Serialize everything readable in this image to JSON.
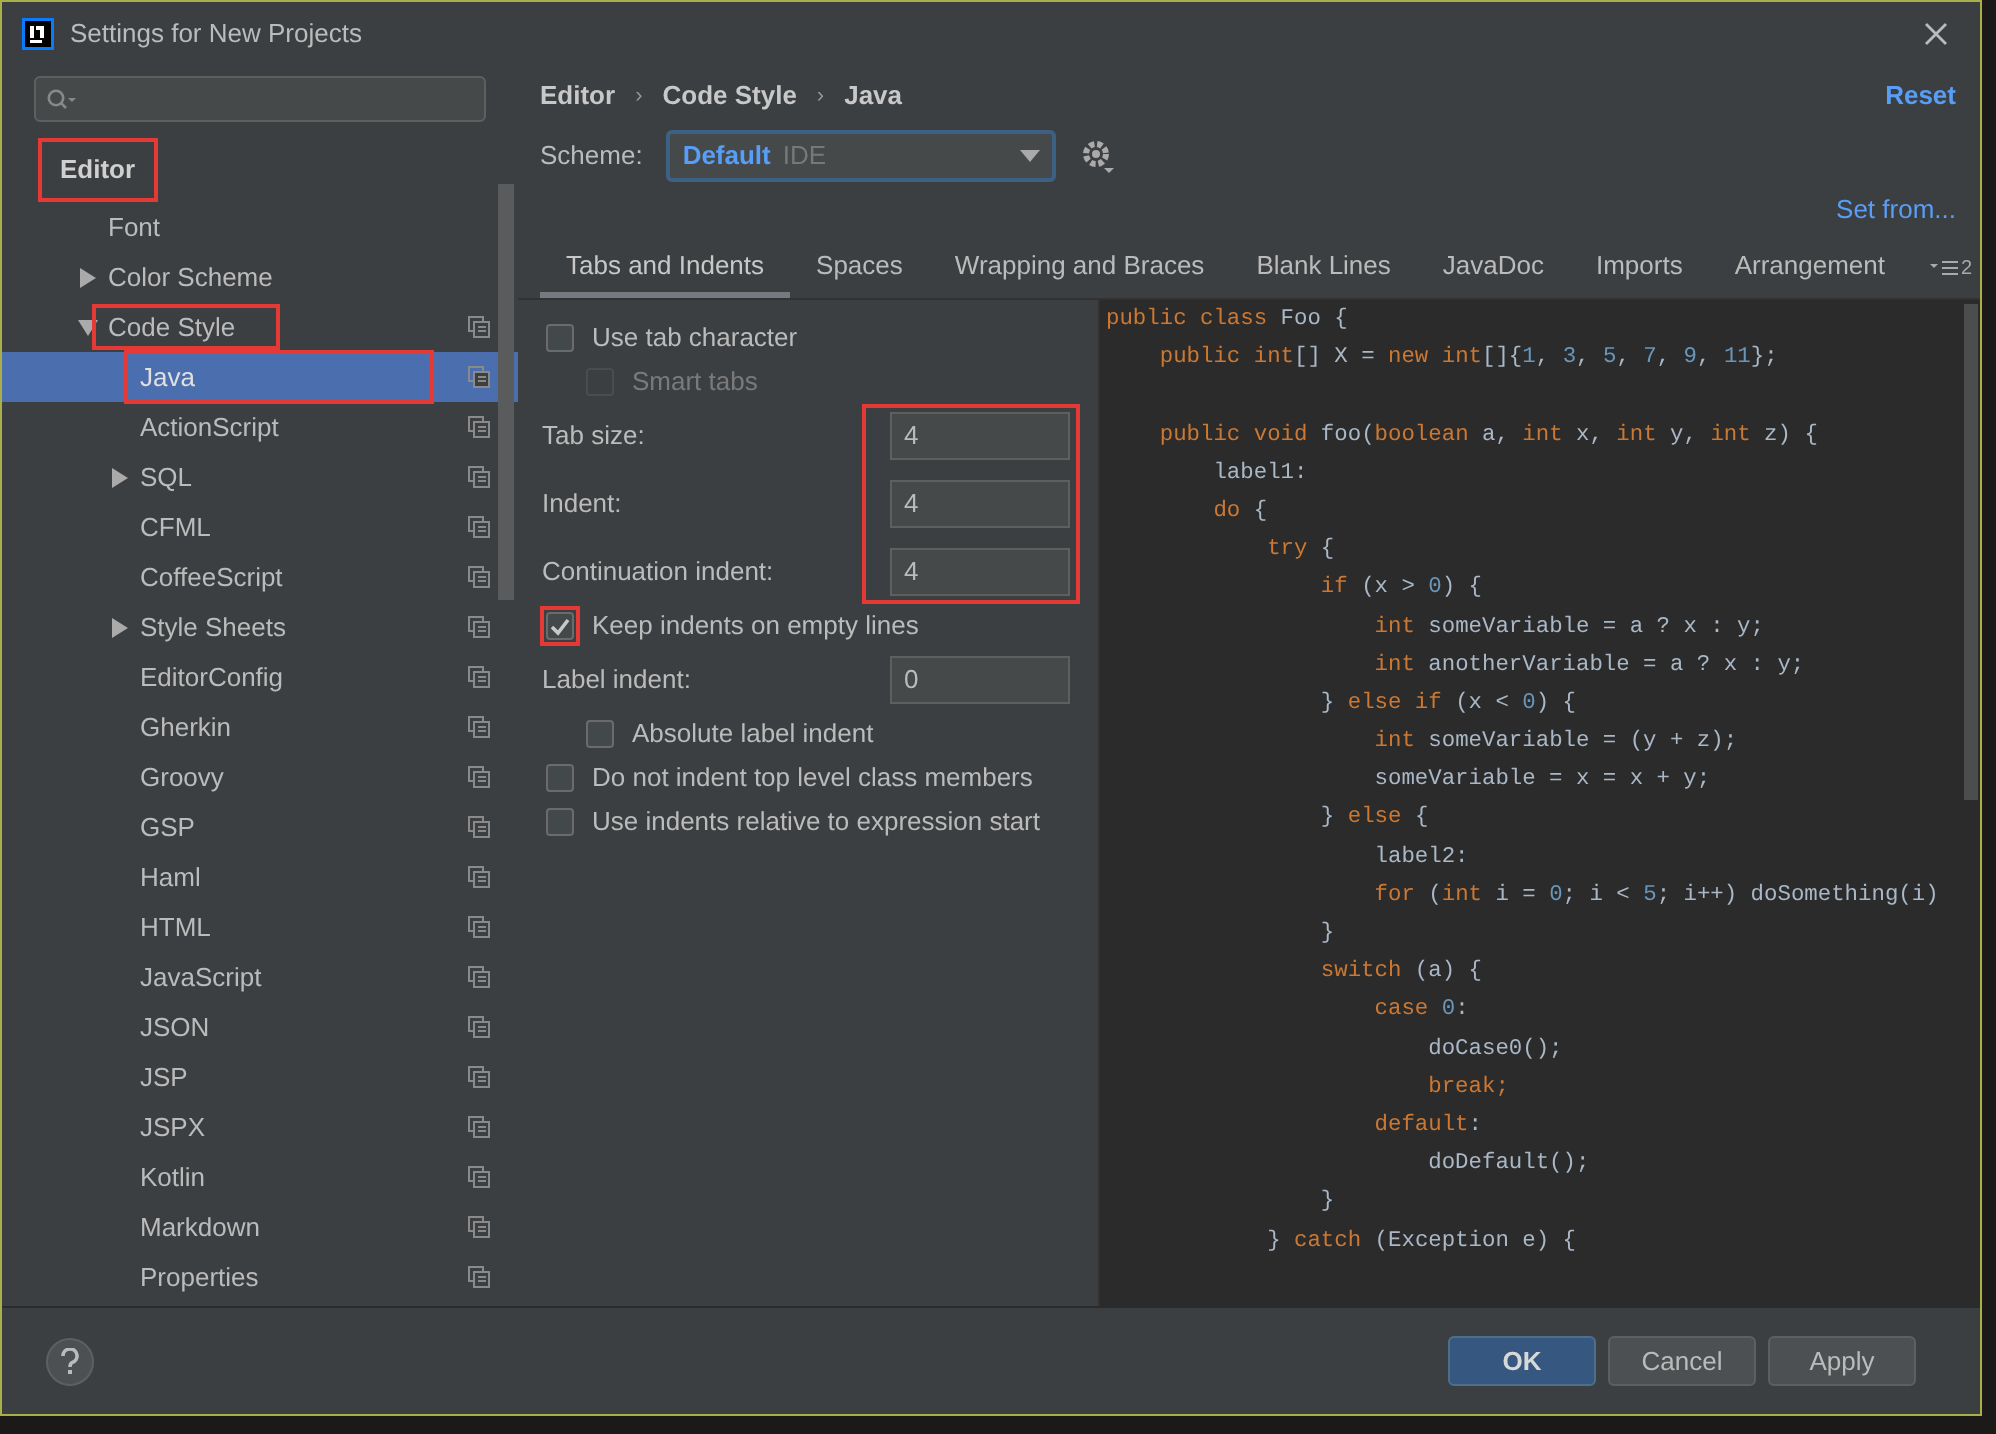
{
  "window": {
    "title": "Settings for New Projects"
  },
  "sidebar": {
    "header": {
      "label": "Editor",
      "highlighted": true
    },
    "items": [
      {
        "label": "Font",
        "selected": false,
        "highlighted": false
      },
      {
        "label": "Color Scheme",
        "expanded": false,
        "selected": false,
        "highlighted": false
      },
      {
        "label": "Code Style",
        "expanded": true,
        "selected": false,
        "highlighted": true,
        "scheme_icon": true,
        "children": [
          {
            "label": "Java",
            "selected": true,
            "highlighted": true,
            "scheme_icon": true
          },
          {
            "label": "ActionScript",
            "selected": false,
            "highlighted": false,
            "scheme_icon": true
          },
          {
            "label": "SQL",
            "expanded": false,
            "selected": false,
            "highlighted": false,
            "scheme_icon": true
          },
          {
            "label": "CFML",
            "selected": false,
            "highlighted": false,
            "scheme_icon": true
          },
          {
            "label": "CoffeeScript",
            "selected": false,
            "highlighted": false,
            "scheme_icon": true
          },
          {
            "label": "Style Sheets",
            "expanded": false,
            "selected": false,
            "highlighted": false,
            "scheme_icon": true
          },
          {
            "label": "EditorConfig",
            "selected": false,
            "highlighted": false,
            "scheme_icon": true
          },
          {
            "label": "Gherkin",
            "selected": false,
            "highlighted": false,
            "scheme_icon": true
          },
          {
            "label": "Groovy",
            "selected": false,
            "highlighted": false,
            "scheme_icon": true
          },
          {
            "label": "GSP",
            "selected": false,
            "highlighted": false,
            "scheme_icon": true
          },
          {
            "label": "Haml",
            "selected": false,
            "highlighted": false,
            "scheme_icon": true
          },
          {
            "label": "HTML",
            "selected": false,
            "highlighted": false,
            "scheme_icon": true
          },
          {
            "label": "JavaScript",
            "selected": false,
            "highlighted": false,
            "scheme_icon": true
          },
          {
            "label": "JSON",
            "selected": false,
            "highlighted": false,
            "scheme_icon": true
          },
          {
            "label": "JSP",
            "selected": false,
            "highlighted": false,
            "scheme_icon": true
          },
          {
            "label": "JSPX",
            "selected": false,
            "highlighted": false,
            "scheme_icon": true
          },
          {
            "label": "Kotlin",
            "selected": false,
            "highlighted": false,
            "scheme_icon": true
          },
          {
            "label": "Markdown",
            "selected": false,
            "highlighted": false,
            "scheme_icon": true
          },
          {
            "label": "Properties",
            "selected": false,
            "highlighted": false,
            "scheme_icon": true
          }
        ]
      }
    ]
  },
  "breadcrumb": [
    {
      "kind": "crumb",
      "text": "Editor"
    },
    {
      "kind": "separator",
      "text": "›"
    },
    {
      "kind": "crumb",
      "text": "Code Style"
    },
    {
      "kind": "separator",
      "text": "›"
    },
    {
      "kind": "crumb",
      "text": "Java"
    }
  ],
  "reset": "Reset",
  "scheme": {
    "label": "Scheme:",
    "value": "Default",
    "qualifier": "IDE"
  },
  "set_from": "Set from...",
  "tabs": [
    {
      "label": "Tabs and Indents",
      "selected": true
    },
    {
      "label": "Spaces",
      "selected": false
    },
    {
      "label": "Wrapping and Braces",
      "selected": false
    },
    {
      "label": "Blank Lines",
      "selected": false
    },
    {
      "label": "JavaDoc",
      "selected": false
    },
    {
      "label": "Imports",
      "selected": false
    },
    {
      "label": "Arrangement",
      "selected": false
    }
  ],
  "tabs_overflow": "2",
  "options": [
    {
      "kind": "checkbox",
      "label": "Use tab character",
      "checked": false,
      "disabled": false,
      "highlighted": false,
      "children": [
        {
          "kind": "checkbox",
          "label": "Smart tabs",
          "checked": false,
          "disabled": true,
          "highlighted": false
        }
      ]
    },
    {
      "kind": "field_group",
      "highlighted": true,
      "fields": [
        {
          "label": "Tab size:",
          "value": "4"
        },
        {
          "label": "Indent:",
          "value": "4"
        },
        {
          "label": "Continuation indent:",
          "value": "4"
        }
      ]
    },
    {
      "kind": "checkbox",
      "label": "Keep indents on empty lines",
      "checked": true,
      "disabled": false,
      "highlighted": true
    },
    {
      "kind": "field_group",
      "highlighted": false,
      "fields": [
        {
          "label": "Label indent:",
          "value": "0"
        }
      ],
      "children": [
        {
          "kind": "checkbox",
          "label": "Absolute label indent",
          "checked": false,
          "disabled": false,
          "highlighted": false
        }
      ]
    },
    {
      "kind": "checkbox",
      "label": "Do not indent top level class members",
      "checked": false,
      "disabled": false,
      "highlighted": false
    },
    {
      "kind": "checkbox",
      "label": "Use indents relative to expression start",
      "checked": false,
      "disabled": false,
      "highlighted": false
    }
  ],
  "code": [
    {
      "kind": "code",
      "tokens": [
        {
          "text": "public class ",
          "kind": "kw"
        },
        {
          "text": "Foo {",
          "kind": "plain"
        }
      ]
    },
    {
      "kind": "code",
      "tokens": [
        {
          "text": "    public int",
          "kind": "kw"
        },
        {
          "text": "[] X = ",
          "kind": "plain"
        },
        {
          "text": "new int",
          "kind": "kw"
        },
        {
          "text": "[]{",
          "kind": "plain"
        },
        {
          "text": "1",
          "kind": "num"
        },
        {
          "text": ", ",
          "kind": "plain"
        },
        {
          "text": "3",
          "kind": "num"
        },
        {
          "text": ", ",
          "kind": "plain"
        },
        {
          "text": "5",
          "kind": "num"
        },
        {
          "text": ", ",
          "kind": "plain"
        },
        {
          "text": "7",
          "kind": "num"
        },
        {
          "text": ", ",
          "kind": "plain"
        },
        {
          "text": "9",
          "kind": "num"
        },
        {
          "text": ", ",
          "kind": "plain"
        },
        {
          "text": "11",
          "kind": "num"
        },
        {
          "text": "};",
          "kind": "plain"
        }
      ]
    },
    {
      "kind": "blank"
    },
    {
      "kind": "code",
      "tokens": [
        {
          "text": "    public void ",
          "kind": "kw"
        },
        {
          "text": "foo(",
          "kind": "plain"
        },
        {
          "text": "boolean ",
          "kind": "kw"
        },
        {
          "text": "a, ",
          "kind": "plain"
        },
        {
          "text": "int ",
          "kind": "kw"
        },
        {
          "text": "x, ",
          "kind": "plain"
        },
        {
          "text": "int ",
          "kind": "kw"
        },
        {
          "text": "y, ",
          "kind": "plain"
        },
        {
          "text": "int ",
          "kind": "kw"
        },
        {
          "text": "z) {",
          "kind": "plain"
        }
      ]
    },
    {
      "kind": "code",
      "tokens": [
        {
          "text": "        label1:",
          "kind": "plain"
        }
      ]
    },
    {
      "kind": "code",
      "tokens": [
        {
          "text": "        do ",
          "kind": "kw"
        },
        {
          "text": "{",
          "kind": "plain"
        }
      ]
    },
    {
      "kind": "code",
      "tokens": [
        {
          "text": "            try ",
          "kind": "kw"
        },
        {
          "text": "{",
          "kind": "plain"
        }
      ]
    },
    {
      "kind": "code",
      "tokens": [
        {
          "text": "                if ",
          "kind": "kw"
        },
        {
          "text": "(x > ",
          "kind": "plain"
        },
        {
          "text": "0",
          "kind": "num"
        },
        {
          "text": ") {",
          "kind": "plain"
        }
      ]
    },
    {
      "kind": "code",
      "tokens": [
        {
          "text": "                    int ",
          "kind": "kw"
        },
        {
          "text": "someVariable = a ? x : y;",
          "kind": "plain"
        }
      ]
    },
    {
      "kind": "code",
      "tokens": [
        {
          "text": "                    int ",
          "kind": "kw"
        },
        {
          "text": "anotherVariable = a ? x : y;",
          "kind": "plain"
        }
      ]
    },
    {
      "kind": "code",
      "tokens": [
        {
          "text": "                } ",
          "kind": "plain"
        },
        {
          "text": "else if ",
          "kind": "kw"
        },
        {
          "text": "(x < ",
          "kind": "plain"
        },
        {
          "text": "0",
          "kind": "num"
        },
        {
          "text": ") {",
          "kind": "plain"
        }
      ]
    },
    {
      "kind": "code",
      "tokens": [
        {
          "text": "                    int ",
          "kind": "kw"
        },
        {
          "text": "someVariable = (y + z);",
          "kind": "plain"
        }
      ]
    },
    {
      "kind": "code",
      "tokens": [
        {
          "text": "                    someVariable = x = x + y;",
          "kind": "plain"
        }
      ]
    },
    {
      "kind": "code",
      "tokens": [
        {
          "text": "                } ",
          "kind": "plain"
        },
        {
          "text": "else ",
          "kind": "kw"
        },
        {
          "text": "{",
          "kind": "plain"
        }
      ]
    },
    {
      "kind": "code",
      "tokens": [
        {
          "text": "                    label2:",
          "kind": "plain"
        }
      ]
    },
    {
      "kind": "code",
      "tokens": [
        {
          "text": "                    for ",
          "kind": "kw"
        },
        {
          "text": "(",
          "kind": "plain"
        },
        {
          "text": "int ",
          "kind": "kw"
        },
        {
          "text": "i = ",
          "kind": "plain"
        },
        {
          "text": "0",
          "kind": "num"
        },
        {
          "text": "; i < ",
          "kind": "plain"
        },
        {
          "text": "5",
          "kind": "num"
        },
        {
          "text": "; i++) doSomething(i)",
          "kind": "plain"
        }
      ]
    },
    {
      "kind": "code",
      "tokens": [
        {
          "text": "                }",
          "kind": "plain"
        }
      ]
    },
    {
      "kind": "code",
      "tokens": [
        {
          "text": "                switch ",
          "kind": "kw"
        },
        {
          "text": "(a) {",
          "kind": "plain"
        }
      ]
    },
    {
      "kind": "code",
      "tokens": [
        {
          "text": "                    case ",
          "kind": "kw"
        },
        {
          "text": "0",
          "kind": "num"
        },
        {
          "text": ":",
          "kind": "plain"
        }
      ]
    },
    {
      "kind": "code",
      "tokens": [
        {
          "text": "                        doCase0();",
          "kind": "plain"
        }
      ]
    },
    {
      "kind": "code",
      "tokens": [
        {
          "text": "                        break;",
          "kind": "kw"
        }
      ]
    },
    {
      "kind": "code",
      "tokens": [
        {
          "text": "                    default",
          "kind": "kw"
        },
        {
          "text": ":",
          "kind": "plain"
        }
      ]
    },
    {
      "kind": "code",
      "tokens": [
        {
          "text": "                        doDefault();",
          "kind": "plain"
        }
      ]
    },
    {
      "kind": "code",
      "tokens": [
        {
          "text": "                }",
          "kind": "plain"
        }
      ]
    },
    {
      "kind": "code",
      "tokens": [
        {
          "text": "            } ",
          "kind": "plain"
        },
        {
          "text": "catch ",
          "kind": "kw"
        },
        {
          "text": "(Exception e) {",
          "kind": "plain"
        }
      ]
    }
  ],
  "buttons": [
    {
      "label": "OK",
      "kind": "primary"
    },
    {
      "label": "Cancel",
      "kind": "normal"
    },
    {
      "label": "Apply",
      "kind": "normal"
    }
  ]
}
